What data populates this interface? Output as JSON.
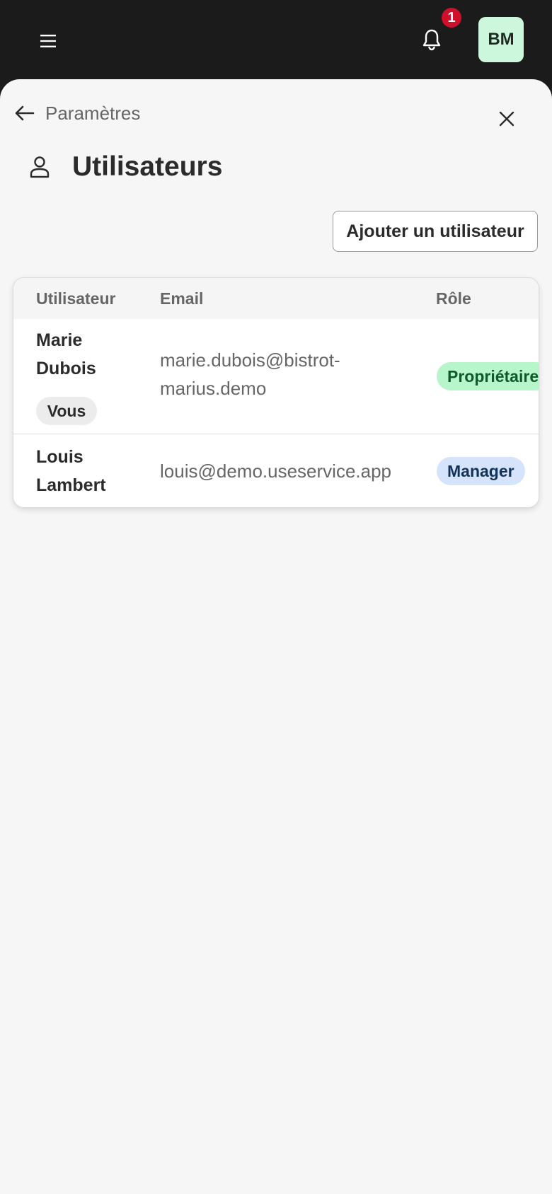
{
  "topbar": {
    "notification_count": "1",
    "avatar_initials": "BM"
  },
  "breadcrumb": {
    "back_label": "Paramètres"
  },
  "page": {
    "title": "Utilisateurs",
    "add_user_label": "Ajouter un utilisateur"
  },
  "table": {
    "columns": [
      "Utilisateur",
      "Email",
      "Rôle"
    ],
    "rows": [
      {
        "first_name": "Marie",
        "last_name": "Dubois",
        "tag": "Vous",
        "email_line1": "marie.dubois@bistrot-",
        "email_line2": "marius.demo",
        "role": "Propriétaire",
        "role_color": "#b7f5cb",
        "role_text_color": "#0f5a2b"
      },
      {
        "first_name": "Louis",
        "last_name": "Lambert",
        "email_line1": "louis@demo.useservice.app",
        "role": "Manager",
        "role_color": "#d6e4fb",
        "role_text_color": "#12325a"
      }
    ]
  },
  "colors": {
    "topbar": "#1b1b1c",
    "sheet": "#f6f6f6",
    "badge": "#d0102a",
    "avatar": "#cdf7dd"
  },
  "icons": [
    "menu-icon",
    "bell-icon",
    "arrow-left-icon",
    "close-icon",
    "user-icon"
  ]
}
